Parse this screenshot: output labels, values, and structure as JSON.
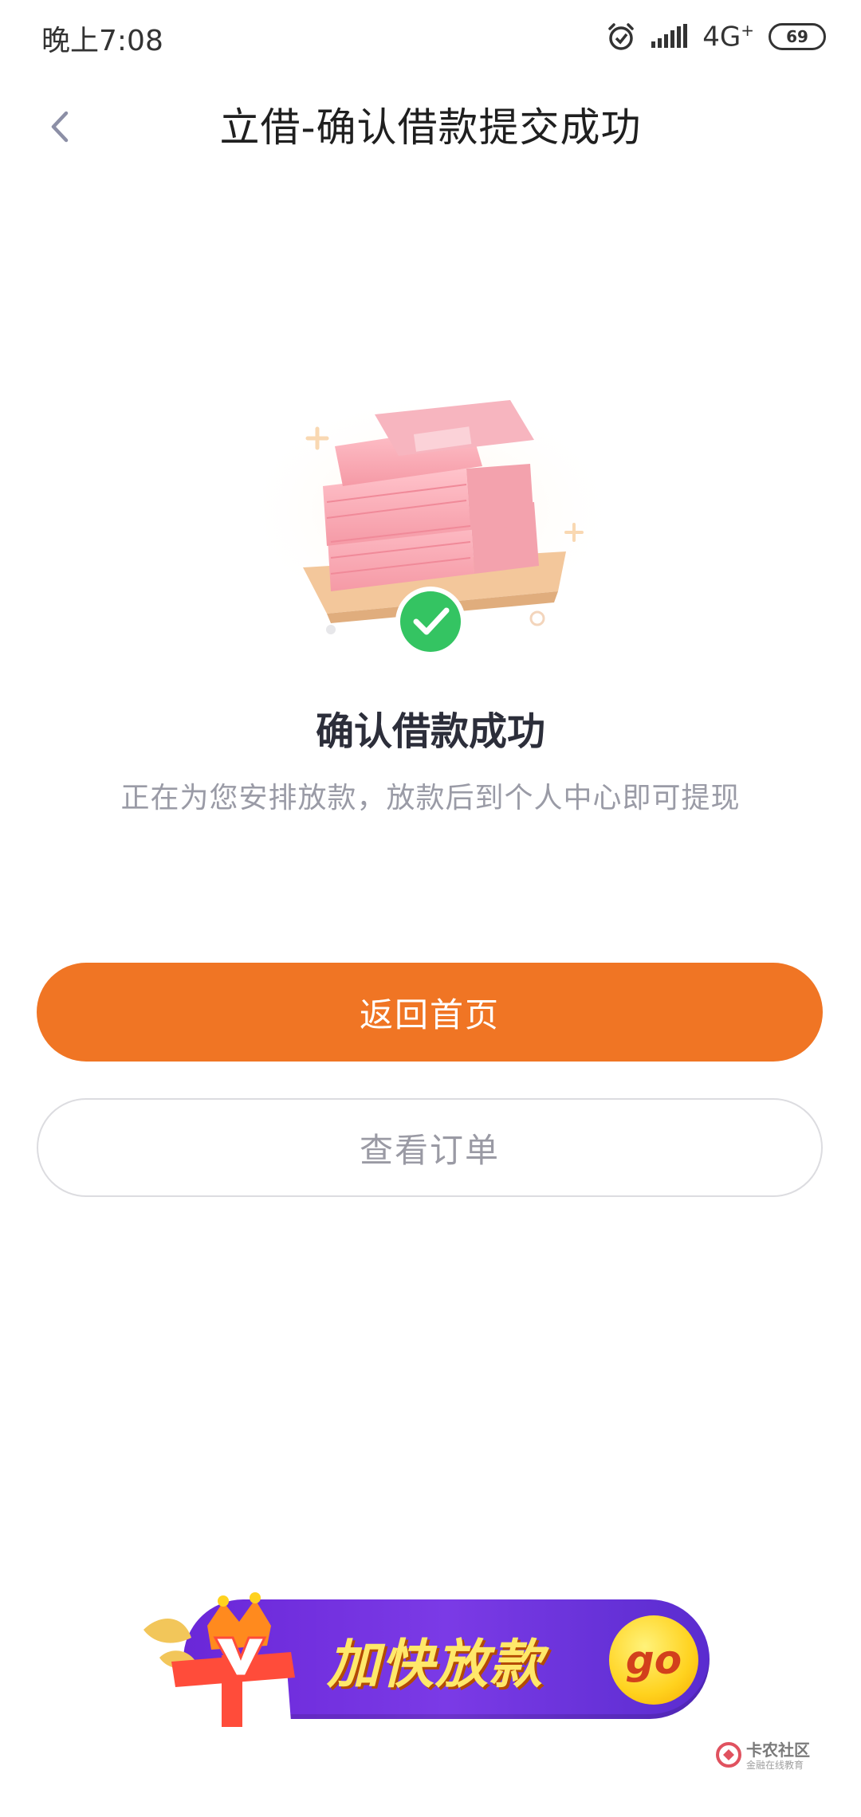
{
  "status_bar": {
    "time": "晚上7:08",
    "network": "4G",
    "battery": "69",
    "icons": [
      "alarm-icon",
      "signal-icon",
      "battery-icon"
    ]
  },
  "header": {
    "title": "立借-确认借款提交成功",
    "back_icon": "chevron-left-icon"
  },
  "result": {
    "title": "确认借款成功",
    "subtitle": "正在为您安排放款，放款后到个人中心即可提现",
    "icon": "check-circle-icon"
  },
  "actions": {
    "primary_label": "返回首页",
    "secondary_label": "查看订单"
  },
  "promo": {
    "text": "加快放款",
    "go_label": "go"
  },
  "watermark": {
    "title": "卡农社区",
    "subtitle": "金融在线教育"
  },
  "colors": {
    "primary": "#f07524",
    "success": "#34c462",
    "promo_purple": "#6a27d8",
    "promo_yellow": "#ffe86a"
  }
}
